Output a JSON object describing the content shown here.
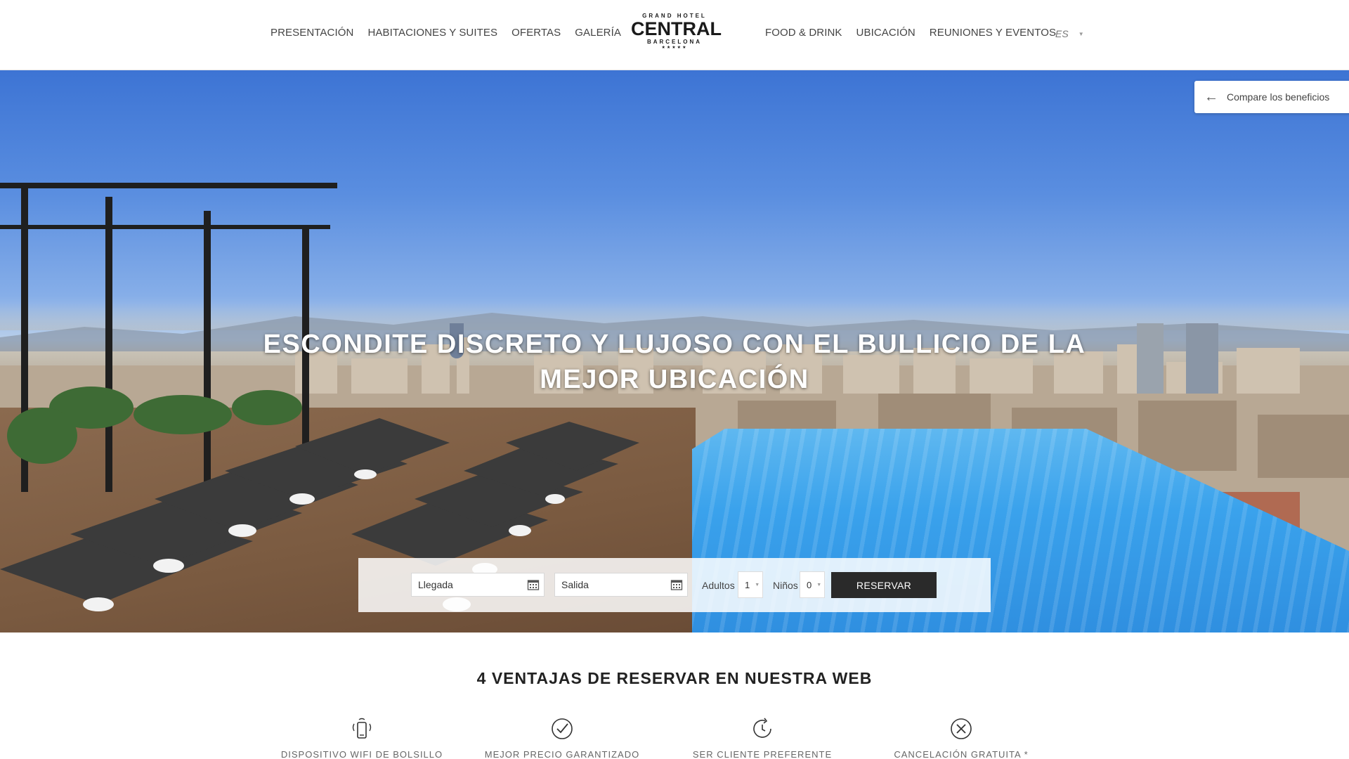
{
  "header": {
    "nav_left": [
      {
        "label": "PRESENTACIÓN"
      },
      {
        "label": "HABITACIONES Y SUITES"
      },
      {
        "label": "OFERTAS"
      },
      {
        "label": "GALERÍA"
      }
    ],
    "nav_right": [
      {
        "label": "FOOD & DRINK"
      },
      {
        "label": "UBICACIÓN"
      },
      {
        "label": "REUNIONES Y EVENTOS"
      }
    ],
    "logo": {
      "line1": "GRAND HOTEL",
      "line2": "CENTRAL",
      "line3": "BARCELONA",
      "stars": "★★★★★"
    },
    "language": "ES"
  },
  "hero": {
    "title": "ESCONDITE DISCRETO Y LUJOSO CON EL BULLICIO DE LA MEJOR UBICACIÓN",
    "compare_label": "Compare los beneficios"
  },
  "booking": {
    "arrival_placeholder": "Llegada",
    "departure_placeholder": "Salida",
    "adults_label": "Adultos",
    "adults_value": "1",
    "children_label": "Niños",
    "children_value": "0",
    "submit_label": "RESERVAR"
  },
  "advantages": {
    "title": "4 VENTAJAS DE RESERVAR EN NUESTRA WEB",
    "items": [
      {
        "label": "DISPOSITIVO WIFI DE BOLSILLO",
        "icon": "pocket-wifi-icon"
      },
      {
        "label": "MEJOR PRECIO GARANTIZADO",
        "icon": "check-circle-icon"
      },
      {
        "label": "SER CLIENTE PREFERENTE",
        "icon": "refresh-clock-icon"
      },
      {
        "label": "CANCELACIÓN GRATUITA *",
        "icon": "cancel-circle-icon"
      }
    ]
  },
  "colors": {
    "reserve_button": "#2a2a2a",
    "pool": "#3aa2ec",
    "sky": "#3d74d4"
  }
}
